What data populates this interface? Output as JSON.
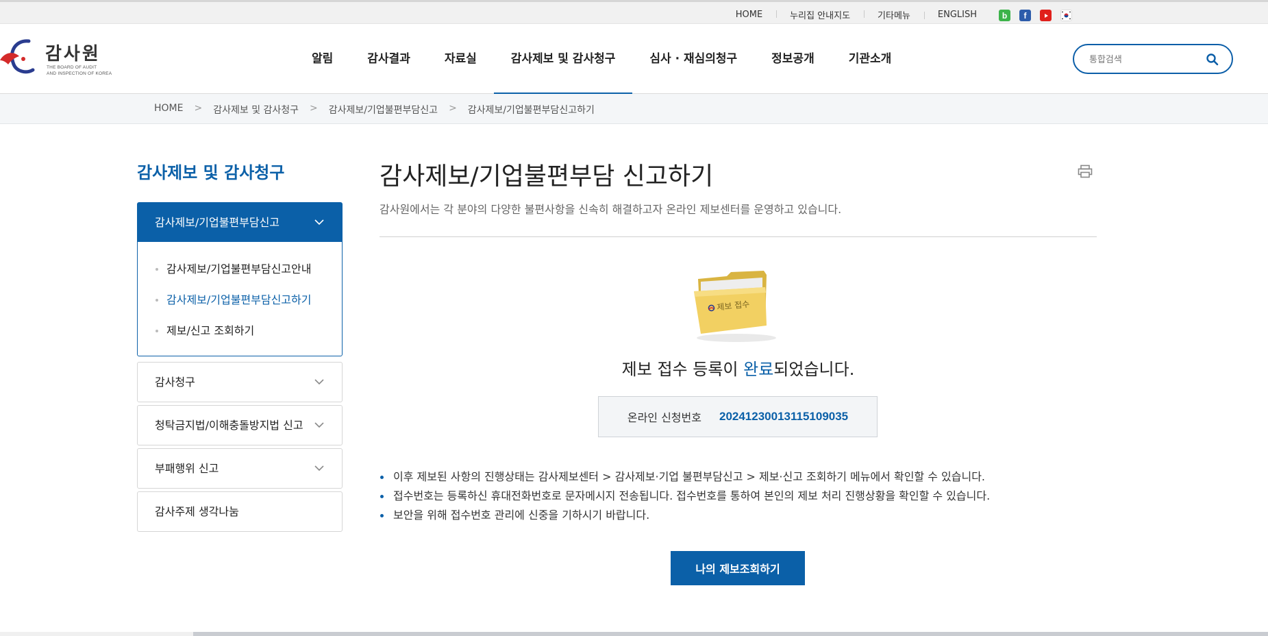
{
  "util": {
    "links": [
      "HOME",
      "누리집 안내지도",
      "기타메뉴",
      "ENGLISH"
    ],
    "sns": [
      "band-icon",
      "facebook-icon",
      "youtube-icon",
      "korea-flag-icon"
    ],
    "band_letter": "b",
    "facebook_letter": "f"
  },
  "logo": {
    "title": "감사원",
    "subtitle_line1": "THE BOARD OF AUDIT",
    "subtitle_line2": "AND INSPECTION OF KOREA"
  },
  "gnb": [
    "알림",
    "감사결과",
    "자료실",
    "감사제보 및 감사청구",
    "심사 · 재심의청구",
    "정보공개",
    "기관소개"
  ],
  "search": {
    "placeholder": "통합검색"
  },
  "breadcrumb": [
    "HOME",
    "감사제보 및 감사청구",
    "감사제보/기업불편부담신고",
    "감사제보/기업불편부담신고하기"
  ],
  "breadcrumb_sep": ">",
  "lnb": {
    "title": "감사제보 및 감사청구",
    "groups": [
      {
        "label": "감사제보/기업불편부담신고",
        "items": [
          "감사제보/기업불편부담신고안내",
          "감사제보/기업불편부담신고하기",
          "제보/신고 조회하기"
        ]
      },
      {
        "label": "감사청구"
      },
      {
        "label": "청탁금지법/이해충돌방지법 신고"
      },
      {
        "label": "부패행위 신고"
      },
      {
        "label": "감사주제 생각나눔"
      }
    ]
  },
  "content": {
    "title": "감사제보/기업불편부담 신고하기",
    "description": "감사원에서는 각 분야의 다양한 불편사항을 신속히 해결하고자 온라인 제보센터를 운영하고 있습니다.",
    "folder_label": "제보 접수",
    "done_pre": "제보 접수 등록이 ",
    "done_hl": "완료",
    "done_post": "되었습니다.",
    "number_label": "온라인 신청번호",
    "number_value": "20241230013115109035",
    "notes": [
      "이후 제보된 사항의 진행상태는 감사제보센터 > 감사제보·기업 불편부담신고 > 제보·신고 조회하기 메뉴에서 확인할 수 있습니다.",
      "접수번호는 등록하신 휴대전화번호로 문자메시지 전송됩니다. 접수번호를 통하여 본인의 제보 처리 진행상황을 확인할 수 있습니다.",
      "보안을 위해 접수번호 관리에 신중을 기하시기 바랍니다."
    ],
    "cta": "나의 제보조회하기"
  },
  "colors": {
    "accent": "#0b60a8",
    "folder": "#f2d062",
    "band": "#3cb34a",
    "facebook": "#2d5cab",
    "youtube": "#e0201c"
  }
}
